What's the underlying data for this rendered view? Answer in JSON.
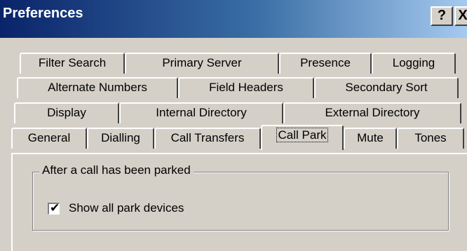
{
  "window": {
    "title": "Preferences",
    "help_label": "?",
    "close_label": "X"
  },
  "tabs": {
    "rows": [
      [
        "Filter Search",
        "Primary Server",
        "Presence",
        "Logging"
      ],
      [
        "Alternate Numbers",
        "Field Headers",
        "Secondary Sort"
      ],
      [
        "Display",
        "Internal Directory",
        "External Directory"
      ],
      [
        "General",
        "Dialling",
        "Call Transfers",
        "Call Park",
        "Mute",
        "Tones"
      ]
    ],
    "selected": "Call Park"
  },
  "call_park": {
    "group_title": "After a call has been parked",
    "show_all_devices": {
      "label": "Show all park devices",
      "checked": true
    }
  }
}
